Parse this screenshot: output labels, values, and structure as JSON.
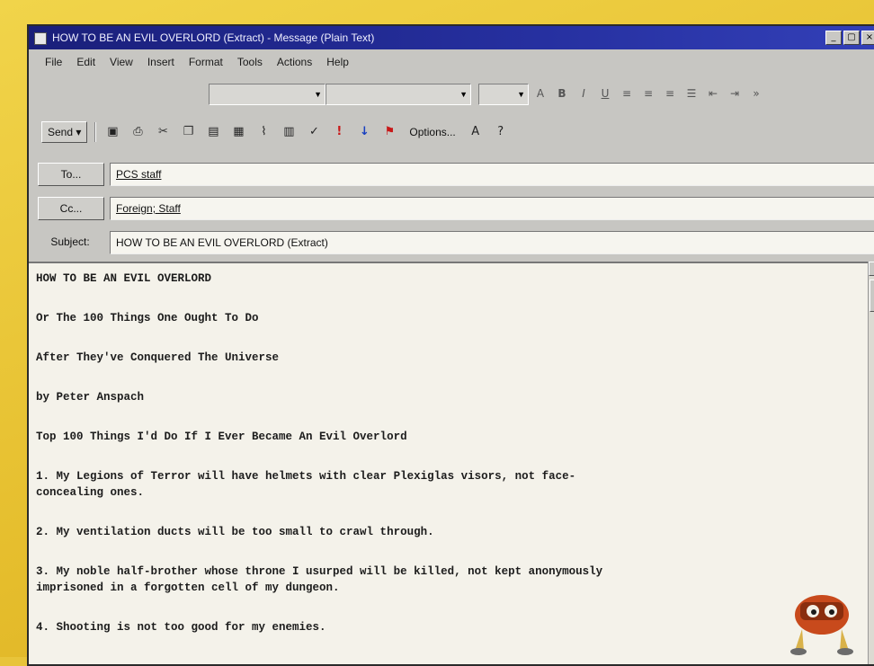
{
  "window": {
    "title": "HOW TO BE AN EVIL OVERLORD (Extract) - Message (Plain Text)",
    "controls": [
      "_",
      "▢",
      "×"
    ]
  },
  "menubar": {
    "items": [
      "File",
      "Edit",
      "View",
      "Insert",
      "Format",
      "Tools",
      "Actions",
      "Help"
    ]
  },
  "toolbar": {
    "send_label": "Send",
    "options_label": "Options..."
  },
  "header": {
    "to_label": "To...",
    "to_value": "PCS staff",
    "cc_label": "Cc...",
    "cc_value": "Foreign; Staff",
    "subject_label": "Subject:",
    "subject_value": "HOW TO BE AN EVIL OVERLORD (Extract)"
  },
  "message": {
    "paragraphs": [
      "HOW TO BE AN EVIL OVERLORD",
      "Or The 100 Things One Ought To Do",
      "After They've Conquered The Universe",
      "by Peter Anspach",
      "Top 100 Things I'd Do If I Ever Became An Evil Overlord",
      "1. My Legions of Terror will have helmets with clear Plexiglas visors, not face-\nconcealing ones.",
      "2. My ventilation ducts will be too small to crawl through.",
      "3. My noble half-brother whose throne I usurped will be killed, not kept anonymously\nimprisoned in a forgotten cell of my dungeon.",
      "4. Shooting is not too good for my enemies."
    ]
  },
  "colors": {
    "titlebar": "#1a1f7a",
    "window_bg": "#c7c6c2",
    "page_bg": "#e8c43a",
    "body_bg": "#f4f2ea"
  }
}
